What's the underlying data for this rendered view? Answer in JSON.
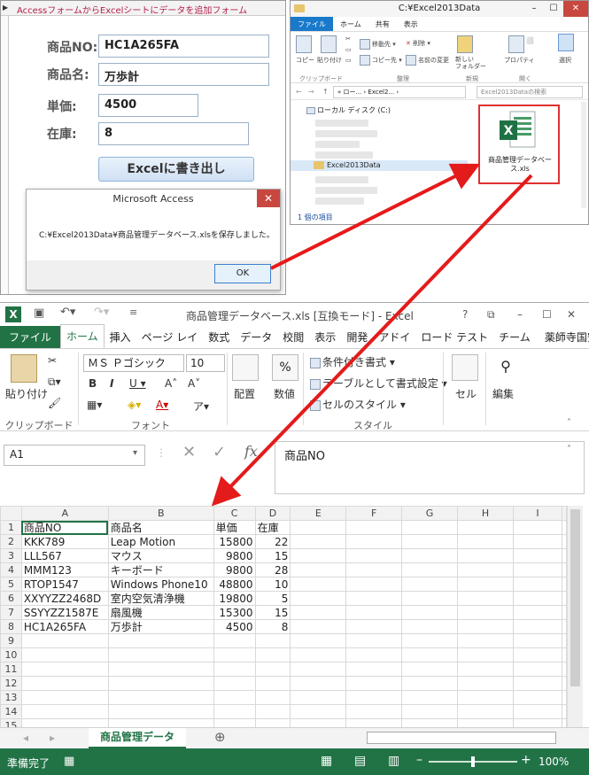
{
  "access": {
    "title": "AccessフォームからExcelシートにデータを追加フォーム",
    "fields": [
      {
        "label": "商品NO:",
        "value": "HC1A265FA"
      },
      {
        "label": "商品名:",
        "value": "万歩計"
      },
      {
        "label": "単価:",
        "value": "4500"
      },
      {
        "label": "在庫:",
        "value": "8"
      }
    ],
    "export_button": "Excelに書き出し",
    "msgbox": {
      "title": "Microsoft Access",
      "message": "C:¥Excel2013Data¥商品管理データベース.xlsを保存しました。",
      "ok": "OK",
      "close": "✕"
    }
  },
  "explorer": {
    "title": "C:¥Excel2013Data",
    "tabs": [
      "ファイル",
      "ホーム",
      "共有",
      "表示"
    ],
    "ribbon": {
      "copy": "コピー",
      "paste": "貼り付け",
      "move_to": "移動先 ▾",
      "copy_to": "コピー先 ▾",
      "delete": "削除 ▾",
      "rename": "名前の変更",
      "new_folder": "新しい\nフォルダー",
      "properties": "プロパティ",
      "select": "選択",
      "groups": [
        "クリップボード",
        "整理",
        "新規",
        "開く"
      ]
    },
    "address": "« ロー... › Excel2... ›",
    "search_placeholder": "Excel2013Dataの検索",
    "local_disk": "ローカル ディスク (C:)",
    "selected_folder": "Excel2013Data",
    "file_name": "商品管理データベース.xls",
    "status": "1 個の項目"
  },
  "excel": {
    "title": "商品管理データベース.xls  [互換モード] - Excel",
    "window_controls": {
      "help": "?",
      "ribbon_display": "⧉",
      "minimize": "–",
      "maximize": "☐",
      "close": "✕"
    },
    "tabs": [
      "ファイル",
      "ホーム",
      "挿入",
      "ページ レイ",
      "数式",
      "データ",
      "校閲",
      "表示",
      "開発",
      "アドイ",
      "ロード テスト",
      "チーム"
    ],
    "user": "薬師寺国安",
    "ribbon": {
      "paste": "貼り付け",
      "clipboard": "クリップボード",
      "font_name": "ＭＳ Ｐゴシック",
      "font_size": "10",
      "font_group": "フォント",
      "align": "配置",
      "number": "数値",
      "cond_format": "条件付き書式 ▾",
      "table_format": "テーブルとして書式設定 ▾",
      "cell_style": "セルのスタイル ▾",
      "style_group": "スタイル",
      "cells": "セル",
      "edit": "編集"
    },
    "name_box": "A1",
    "formula_value": "商品NO",
    "columns": [
      "A",
      "B",
      "C",
      "D",
      "E",
      "F",
      "G",
      "H",
      "I"
    ],
    "rows": [
      [
        "商品NO",
        "商品名",
        "単価",
        "在庫"
      ],
      [
        "KKK789",
        "Leap Motion",
        "15800",
        "22"
      ],
      [
        "LLL567",
        "マウス",
        "9800",
        "15"
      ],
      [
        "MMM123",
        "キーボード",
        "9800",
        "28"
      ],
      [
        "RTOP1547",
        "Windows Phone10",
        "48800",
        "10"
      ],
      [
        "XXYYZZ2468D",
        "室内空気清浄機",
        "19800",
        "5"
      ],
      [
        "SSYYZZ1587E",
        "扇風機",
        "15300",
        "15"
      ],
      [
        "HC1A265FA",
        "万歩計",
        "4500",
        "8"
      ]
    ],
    "row_numbers": [
      "1",
      "2",
      "3",
      "4",
      "5",
      "6",
      "7",
      "8",
      "9",
      "10",
      "11",
      "12",
      "13",
      "14",
      "15"
    ],
    "sheet_tab": "商品管理データ",
    "status": "準備完了",
    "zoom": "100%"
  }
}
